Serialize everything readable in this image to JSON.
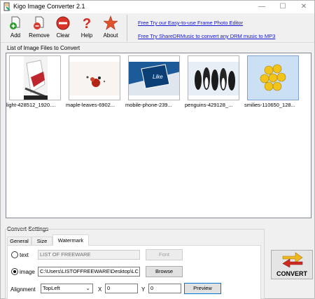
{
  "window": {
    "title": "Kigo Image Converter 2.1"
  },
  "toolbar": {
    "add_label": "Add",
    "remove_label": "Remove",
    "clear_label": "Clear",
    "help_label": "Help",
    "about_label": "About"
  },
  "links": {
    "frame_editor": "Free Try our Easy-to-use Frame Photo Editor",
    "sharedrmusic": "Free Try ShareDRMusic to convert any DRM music to MP3"
  },
  "list": {
    "label": "List of Image Files to Convert",
    "items": [
      {
        "caption": "light-428512_1920....",
        "icon": "image-thumbnail"
      },
      {
        "caption": "maple-leaves-6902...",
        "icon": "image-thumbnail"
      },
      {
        "caption": "mobile-phone-239...",
        "icon": "image-thumbnail"
      },
      {
        "caption": "penguins-429128_...",
        "icon": "image-thumbnail"
      },
      {
        "caption": "smilies-110650_128...",
        "icon": "image-thumbnail",
        "selected": true
      }
    ]
  },
  "settings": {
    "label": "Convert Settings",
    "tabs": [
      "General",
      "Size",
      "Watermark"
    ],
    "active_tab": "Watermark",
    "text_radio_label": "text",
    "text_value": "LIST OF FREEWARE",
    "font_button": "Font",
    "image_radio_label": "image",
    "image_path": "C:\\Users\\LISTOFFREEWARE\\Desktop\\LC",
    "browse_button": "Browse",
    "alignment_label": "Alignment",
    "alignment_value": "TopLeft",
    "x_label": "X",
    "x_value": "0",
    "y_label": "Y",
    "y_value": "0",
    "preview_button": "Preview",
    "selected_mode": "image"
  },
  "convert": {
    "label": "CONVERT"
  },
  "colors": {
    "link": "#1414d2",
    "selection": "#cce0f5"
  }
}
